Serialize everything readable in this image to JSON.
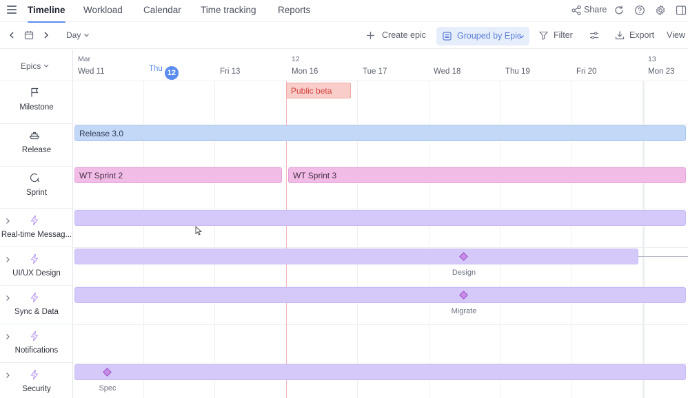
{
  "nav": {
    "tabs": [
      {
        "label": "Timeline",
        "active": true
      },
      {
        "label": "Workload",
        "active": false
      },
      {
        "label": "Calendar",
        "active": false
      },
      {
        "label": "Time tracking",
        "active": false
      },
      {
        "label": "Reports",
        "active": false
      }
    ],
    "share_label": "Share"
  },
  "toolbar": {
    "scale_label": "Day",
    "create_epic_label": "Create epic",
    "grouped_label": "Grouped by Epic",
    "filter_label": "Filter",
    "export_label": "Export",
    "view_label": "View"
  },
  "timeline": {
    "epics_header": "Epics",
    "months": [
      {
        "label": "Mar"
      },
      {
        "label": "12"
      },
      {
        "label": "13"
      }
    ],
    "days": [
      {
        "label": "Wed 11"
      },
      {
        "label": "Thu",
        "badge": "12",
        "today": true
      },
      {
        "label": "Fri 13"
      },
      {
        "label": "Mon 16"
      },
      {
        "label": "Tue 17"
      },
      {
        "label": "Wed 18"
      },
      {
        "label": "Thu 19"
      },
      {
        "label": "Fri 20"
      },
      {
        "label": "Mon 23"
      }
    ],
    "rows": [
      {
        "label": "Milestone",
        "icon": "flag-icon"
      },
      {
        "label": "Release",
        "icon": "ship-icon"
      },
      {
        "label": "Sprint",
        "icon": "sprint-cycle-icon"
      },
      {
        "label": "Real-time Messag...",
        "icon": "lightning-icon"
      },
      {
        "label": "UI/UX Design",
        "icon": "lightning-icon"
      },
      {
        "label": "Sync & Data",
        "icon": "lightning-icon"
      },
      {
        "label": "Notifications",
        "icon": "lightning-icon"
      },
      {
        "label": "Security",
        "icon": "lightning-icon"
      }
    ],
    "bars": {
      "public_beta": "Public beta",
      "release": "Release 3.0",
      "sprint2": "WT Sprint 2",
      "sprint3": "WT Sprint 3"
    },
    "milestones": {
      "design": "Design",
      "migrate": "Migrate",
      "spec": "Spec"
    }
  },
  "colors": {
    "accent": "#5b8def",
    "release_bar": "#c3d7f7",
    "sprint_bar": "#f1bde6",
    "epic_bar": "#d5c9f9",
    "milestone_bar": "#f9cdc9",
    "today_line": "#f3b4bf"
  }
}
